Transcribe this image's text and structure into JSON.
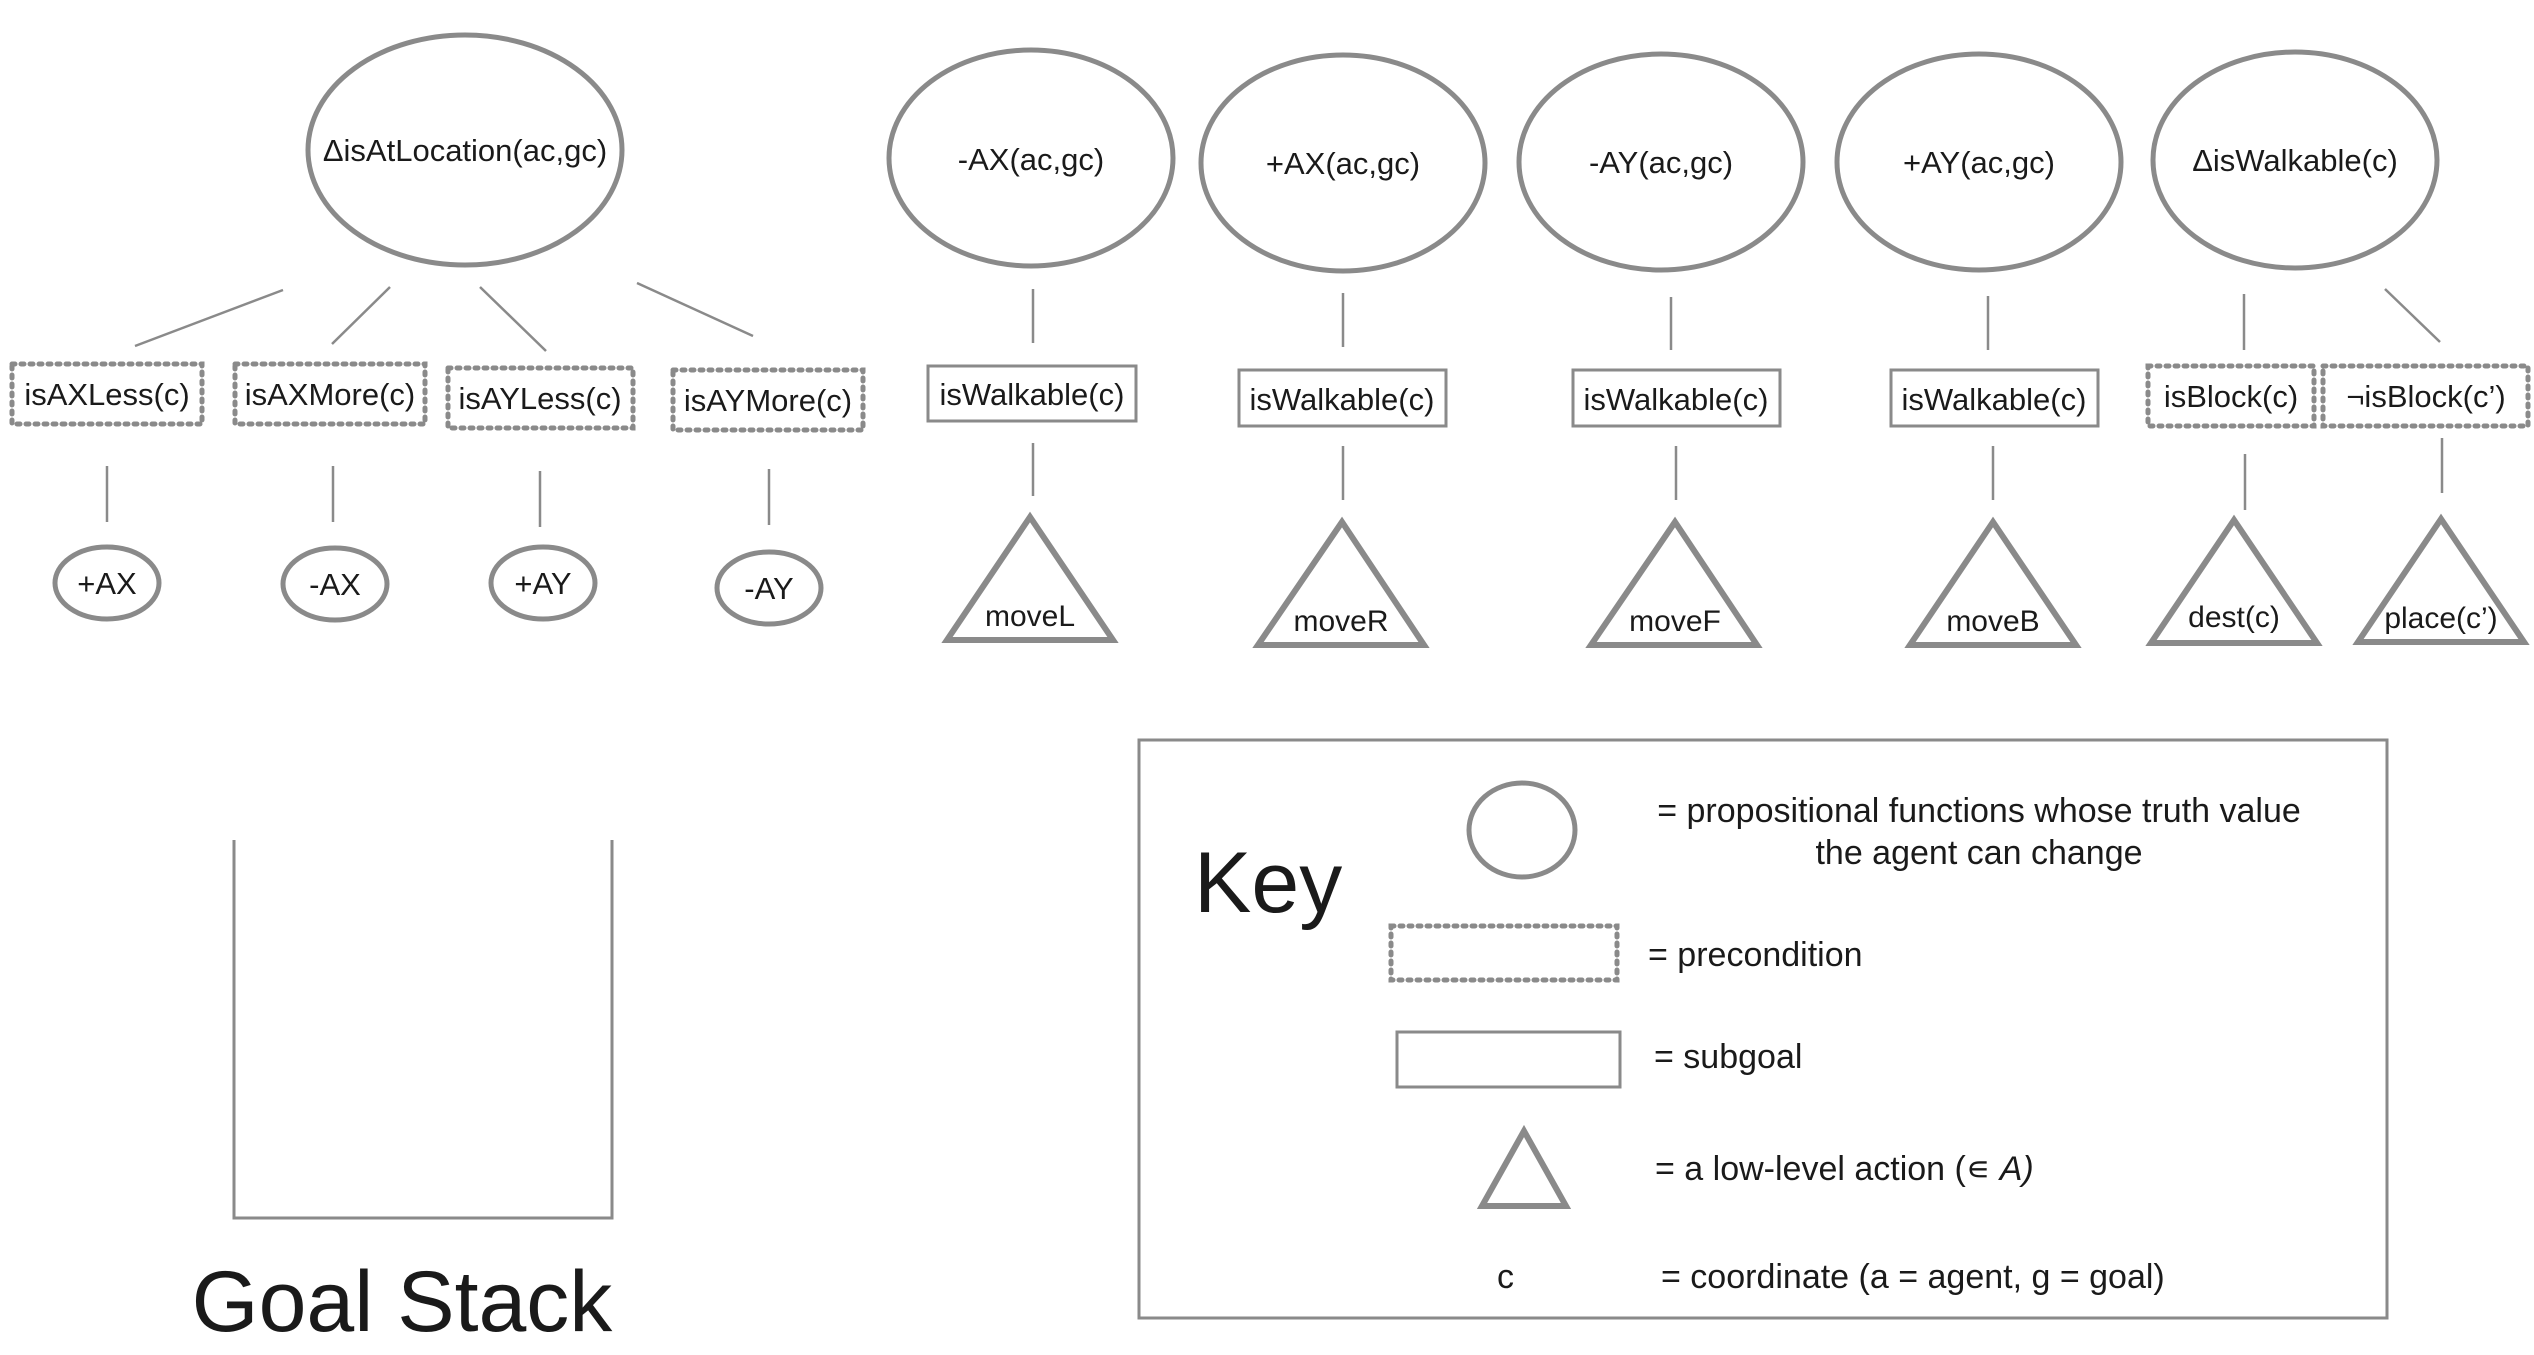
{
  "colors": {
    "stroke": "#8a8a8a",
    "text": "#1a1a1a",
    "background": "#ffffff"
  },
  "tree1": {
    "root": "ΔisAtLocation(ac,gc)",
    "preconditions": [
      "isAXLess(c)",
      "isAXMore(c)",
      "isAYLess(c)",
      "isAYMore(c)"
    ],
    "leaves": [
      "+AX",
      "-AX",
      "+AY",
      "-AY"
    ]
  },
  "trees": [
    {
      "root": "-AX(ac,gc)",
      "subgoal": "isWalkable(c)",
      "action": "moveL"
    },
    {
      "root": "+AX(ac,gc)",
      "subgoal": "isWalkable(c)",
      "action": "moveR"
    },
    {
      "root": "-AY(ac,gc)",
      "subgoal": "isWalkable(c)",
      "action": "moveF"
    },
    {
      "root": "+AY(ac,gc)",
      "subgoal": "isWalkable(c)",
      "action": "moveB"
    }
  ],
  "tree6": {
    "root": "ΔisWalkable(c)",
    "preconditions": [
      "isBlock(c)",
      "¬isBlock(c’)"
    ],
    "actions": [
      "dest(c)",
      "place(c’)"
    ]
  },
  "goal_stack": {
    "title": "Goal Stack"
  },
  "key": {
    "title": "Key",
    "circle_line1": "= propositional functions whose truth value",
    "circle_line2": "the agent can change",
    "precondition": "= precondition",
    "subgoal": "= subgoal",
    "action_prefix": "= a low-level action (∊ ",
    "action_A": "A",
    "action_suffix": ")",
    "coord_symbol": "c",
    "coordinate": "= coordinate (a = agent, g = goal)"
  }
}
